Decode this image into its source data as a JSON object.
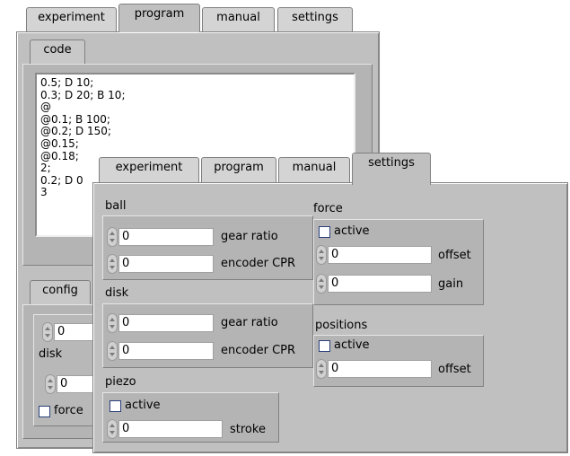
{
  "back_window": {
    "tabs": [
      "experiment",
      "program",
      "manual",
      "settings"
    ],
    "active_tab": "program",
    "code_tab": "code",
    "code_lines": "0.5; D 10;\n0.3; D 20; B 10;\n@\n@0.1; B 100;\n@0.2; D 150;\n@0.15;\n@0.18;\n2;\n0.2; D 0\n3",
    "config_tab": "config",
    "config_value_1": "0",
    "disk_label": "disk",
    "config_value_2": "0",
    "force_label": "force"
  },
  "front_window": {
    "tabs": [
      "experiment",
      "program",
      "manual",
      "settings"
    ],
    "active_tab": "settings",
    "ball": {
      "label": "ball",
      "gear_ratio_value": "0",
      "gear_ratio_label": "gear ratio",
      "encoder_value": "0",
      "encoder_label": "encoder CPR"
    },
    "disk": {
      "label": "disk",
      "gear_ratio_value": "0",
      "gear_ratio_label": "gear ratio",
      "encoder_value": "0",
      "encoder_label": "encoder CPR"
    },
    "piezo": {
      "label": "piezo",
      "active_label": "active",
      "stroke_value": "0",
      "stroke_label": "stroke"
    },
    "force": {
      "label": "force",
      "active_label": "active",
      "offset_value": "0",
      "offset_label": "offset",
      "gain_value": "0",
      "gain_label": "gain"
    },
    "positions": {
      "label": "positions",
      "active_label": "active",
      "offset_value": "0",
      "offset_label": "offset"
    }
  }
}
